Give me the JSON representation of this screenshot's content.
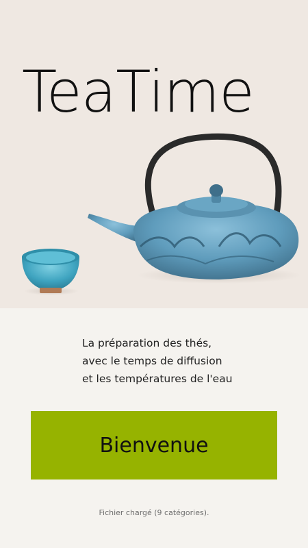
{
  "app": {
    "title": "TeaTime"
  },
  "hero": {
    "image_subject": "cast-iron-teapot-and-teacup"
  },
  "description": {
    "lines": [
      "La préparation des thés,",
      "avec le temps de diffusion",
      "et les températures de l'eau"
    ]
  },
  "welcome_button": {
    "label": "Bienvenue"
  },
  "status": {
    "text": "Fichier chargé (9 catégories)."
  },
  "colors": {
    "hero_background": "#efe8e2",
    "page_background": "#f5f3ef",
    "accent_green": "#96b300",
    "teapot_blue": "#5f9cbc",
    "handle_dark": "#2a2a2a"
  }
}
